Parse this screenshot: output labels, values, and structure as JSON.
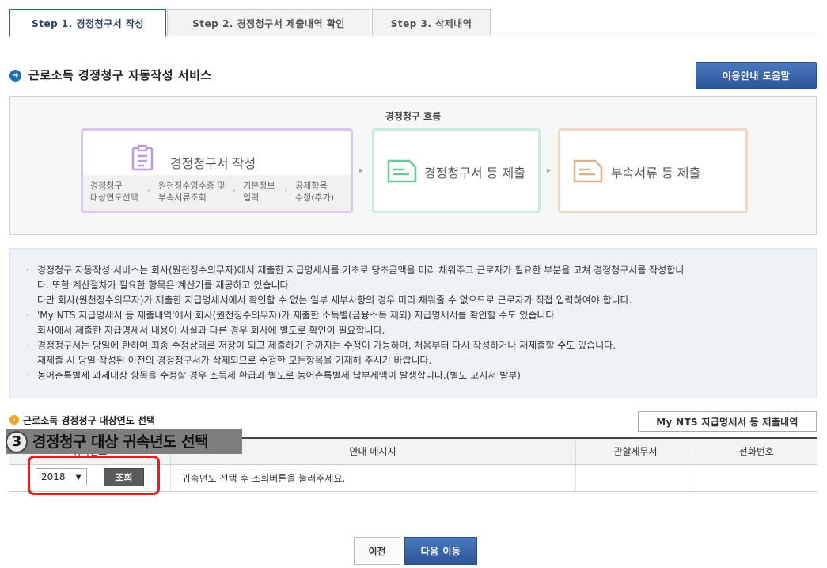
{
  "tabs": [
    {
      "label": "Step 1. 경정청구서 작성"
    },
    {
      "label": "Step 2. 경정청구서 제출내역 확인"
    },
    {
      "label": "Step 3. 삭제내역"
    }
  ],
  "page_title": "근로소득 경정청구 자동작성 서비스",
  "help_button": "이용안내 도움말",
  "flow": {
    "title": "경정청구 흐름",
    "card1_label": "경정청구서 작성",
    "card1_steps": [
      {
        "line1": "경정청구",
        "line2": "대상연도선택"
      },
      {
        "line1": "원천징수영수증 및",
        "line2": "부속서류조회"
      },
      {
        "line1": "기본정보",
        "line2": "입력"
      },
      {
        "line1": "공제항목",
        "line2": "수정(추가)"
      }
    ],
    "card2_label": "경정청구서 등 제출",
    "card3_label": "부속서류 등 제출"
  },
  "info_lines": [
    {
      "bullet": true,
      "text": "경정청구 자동작성 서비스는 회사(원천징수의무자)에서 제출한 지급명세서를 기초로 당초금액을 미리 채워주고 근로자가 필요한 부분을 고쳐 경정청구서를 작성합니"
    },
    {
      "bullet": false,
      "text": "다. 또한 계산절차가 필요한 항목은 계산기를 제공하고 있습니다."
    },
    {
      "bullet": false,
      "text": "다만 회사(원천징수의무자)가 제출한 지급명세서에서 확인할 수 없는 일부 세부사항의 경우 미리 채워줄 수 없으므로 근로자가 직접 입력하여야 합니다."
    },
    {
      "bullet": true,
      "text": "'My NTS 지급명세서 등 제출내역'에서 회사(원천징수의무자)가 제출한 소득별(금융소득 제외) 지급명세서를 확인할 수도 있습니다."
    },
    {
      "bullet": false,
      "text": "회사에서 제출한 지급명세서 내용이 사실과 다른 경우 회사에 별도로 확인이 필요합니다."
    },
    {
      "bullet": true,
      "text": "경정청구서는 당일에 한하여 최종 수정상태로 저장이 되고 제출하기 전까지는 수정이 가능하며, 처음부터 다시 작성하거나 재제출할 수도 있습니다."
    },
    {
      "bullet": false,
      "text": "재제출 시 당일 작성된 이전의 경정청구서가 삭제되므로 수정한 모든항목을 기재해 주시기 바랍니다."
    },
    {
      "bullet": true,
      "text": "농어촌특별세 과세대상 항목을 수정할 경우 소득세 환급과 별도로 농어촌특별세 납부세액이 발생합니다.(별도 고지서 발부)"
    }
  ],
  "section_title": "근로소득 경정청구 대상연도 선택",
  "mynts_button": "My NTS 지급명세서 등 제출내역",
  "table": {
    "headers": [
      "귀속년도",
      "안내 메시지",
      "관할세무서",
      "전화번호"
    ],
    "year_value": "2018",
    "search_label": "조회",
    "message": "귀속년도 선택 후 조회버튼을 눌러주세요.",
    "tax_office": "",
    "phone": ""
  },
  "annotation": {
    "number": "3",
    "text": "경정청구 대상 귀속년도 선택"
  },
  "buttons": {
    "prev": "이전",
    "next": "다음 이동"
  }
}
